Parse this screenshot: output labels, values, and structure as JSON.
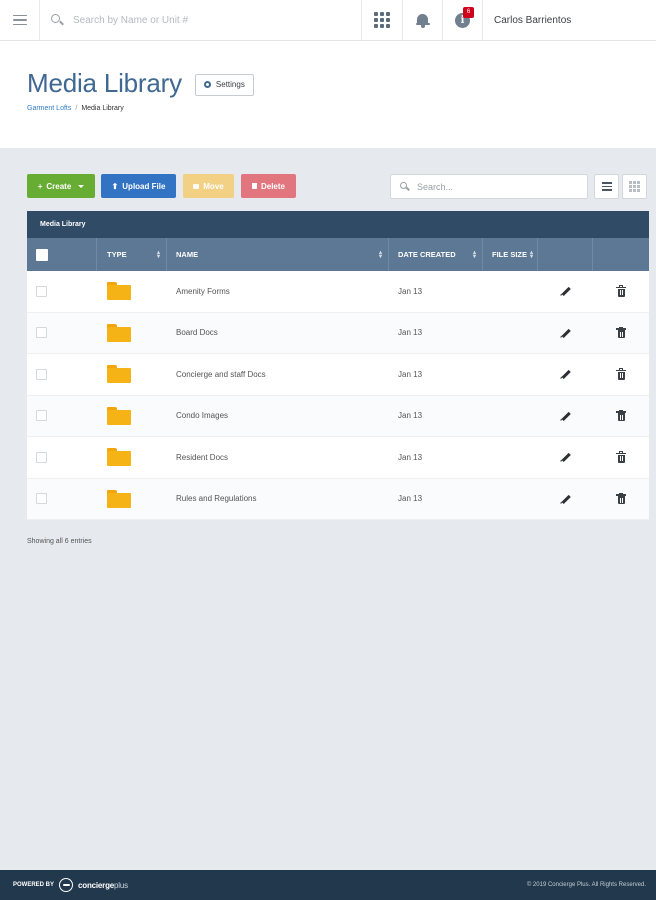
{
  "topbar": {
    "search_placeholder": "Search by Name or Unit #",
    "notification_count": "6",
    "user_name": "Carlos Barrientos",
    "icons": [
      "menu-icon",
      "search-icon",
      "apps-grid-icon",
      "bell-icon",
      "info-icon"
    ]
  },
  "header": {
    "title": "Media Library",
    "settings_label": "Settings",
    "breadcrumb": {
      "link": "Garment Lofts",
      "separator": "/",
      "current": "Media Library"
    }
  },
  "toolbar": {
    "create_label": "Create",
    "upload_label": "Upload File",
    "move_label": "Move",
    "delete_label": "Delete",
    "search_placeholder": "Search..."
  },
  "table": {
    "title": "Media Library",
    "columns": {
      "type": "TYPE",
      "name": "NAME",
      "date_created": "DATE CREATED",
      "file_size": "FILE SIZE"
    },
    "rows": [
      {
        "name": "Amenity Forms",
        "date": "Jan 13"
      },
      {
        "name": "Board Docs",
        "date": "Jan 13"
      },
      {
        "name": "Concierge and staff Docs",
        "date": "Jan 13"
      },
      {
        "name": "Condo Images",
        "date": "Jan 13"
      },
      {
        "name": "Resident Docs",
        "date": "Jan 13"
      },
      {
        "name": "Rules and Regulations",
        "date": "Jan 13"
      }
    ],
    "entries_text": "Showing all 6 entries"
  },
  "footer": {
    "powered_by": "POWERED BY",
    "brand_main": "concierge",
    "brand_plus": "plus",
    "copyright": "© 2019 Concierge Plus. All Rights Reserved."
  },
  "colors": {
    "accent": "#3f6892",
    "create": "#67ad34",
    "upload": "#3273c4",
    "move": "#f2d185",
    "delete": "#e2767e",
    "table_title": "#2f4b66",
    "table_header": "#5c7894",
    "folder": "#f5b316",
    "footer": "#22384d"
  }
}
